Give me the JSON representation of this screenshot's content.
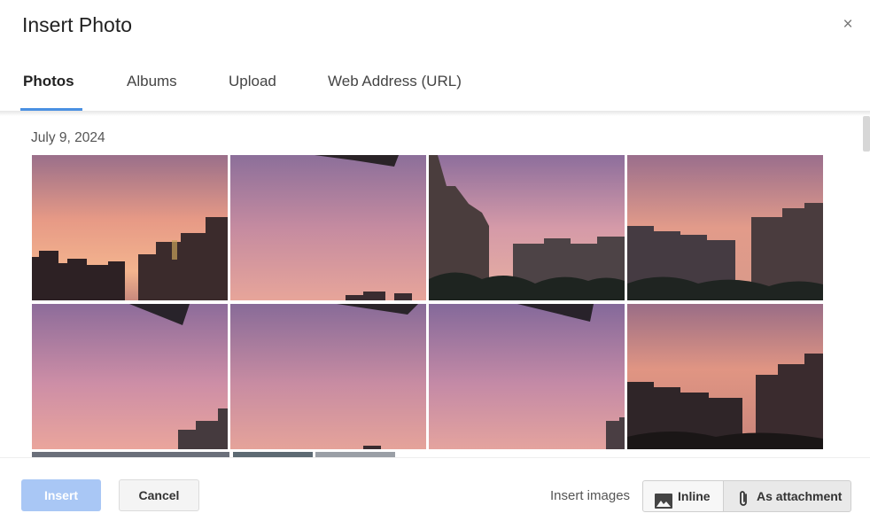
{
  "dialog": {
    "title": "Insert Photo",
    "close_label": "×"
  },
  "tabs": [
    {
      "label": "Photos",
      "active": true
    },
    {
      "label": "Albums",
      "active": false
    },
    {
      "label": "Upload",
      "active": false
    },
    {
      "label": "Web Address (URL)",
      "active": false
    }
  ],
  "gallery": {
    "date_label": "July 9, 2024"
  },
  "footer": {
    "insert_label": "Insert",
    "cancel_label": "Cancel",
    "insert_images_label": "Insert images",
    "inline_label": "Inline",
    "attachment_label": "As attachment",
    "inline_icon": "image-icon",
    "attachment_icon": "paperclip-icon"
  },
  "colors": {
    "accent": "#4a90e2",
    "insert_disabled": "#a9c7f5"
  }
}
